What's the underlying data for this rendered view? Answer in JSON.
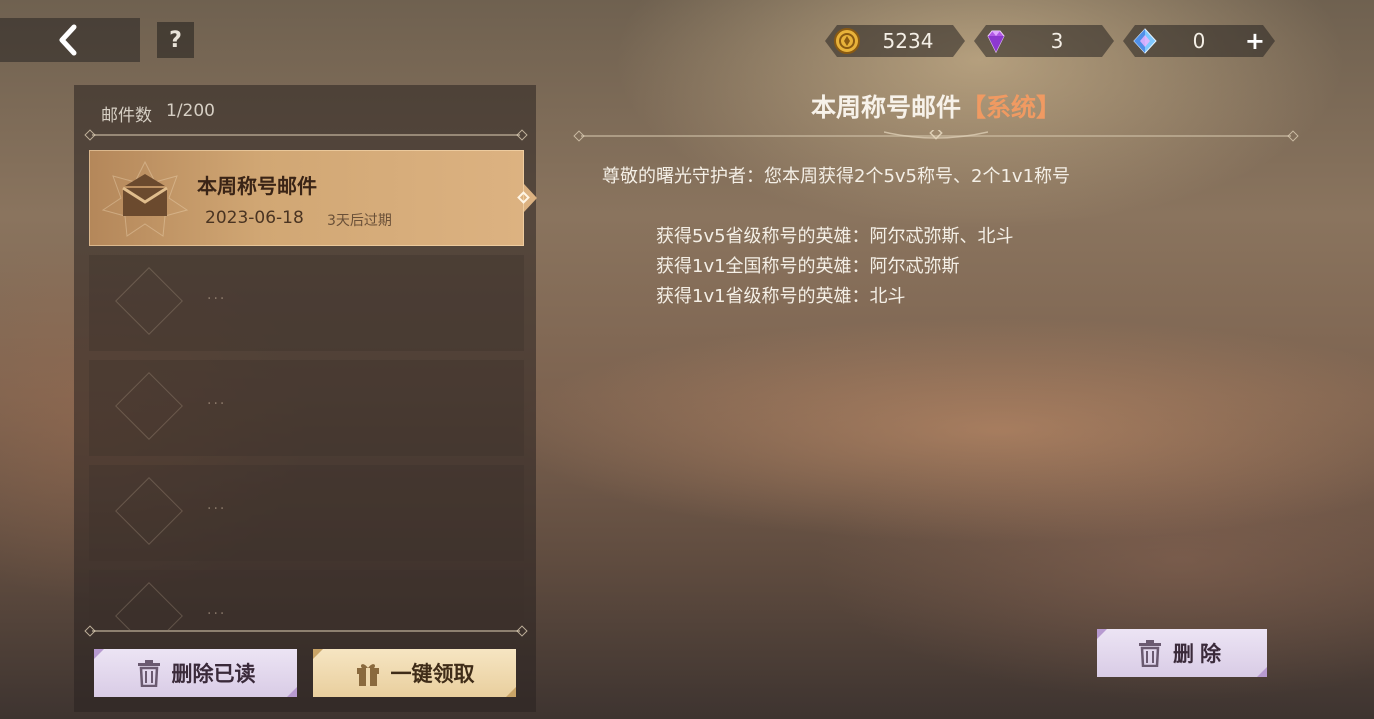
{
  "top_bar": {
    "back_icon": "chevron-left-icon",
    "help_label": "?",
    "currencies": [
      {
        "icon": "gold-coin-icon",
        "value": "5234"
      },
      {
        "icon": "purple-gem-icon",
        "value": "3"
      },
      {
        "icon": "blue-crystal-icon",
        "value": "0",
        "plus": "+"
      }
    ]
  },
  "mailbox": {
    "count_label": "邮件数",
    "count_value": "1/200",
    "mails": [
      {
        "title": "本周称号邮件",
        "date": "2023-06-18",
        "expire": "3天后过期",
        "selected": true
      }
    ],
    "empty_placeholder": "···",
    "buttons": {
      "delete_read": "删除已读",
      "claim_all": "一键领取"
    }
  },
  "mail_detail": {
    "title": "本周称号邮件",
    "tag": "【系统】",
    "greeting": "尊敬的曙光守护者：您本周获得2个5v5称号、2个1v1称号",
    "lines": [
      "获得5v5省级称号的英雄：阿尔忒弥斯、北斗",
      "获得1v1全国称号的英雄：阿尔忒弥斯",
      "获得1v1省级称号的英雄：北斗"
    ],
    "delete_label": "删除"
  },
  "colors": {
    "tag": "#f09a62",
    "selected_item": "#d1a774",
    "button_lavender": "#e3d8ee",
    "button_gold": "#efd9ae"
  }
}
